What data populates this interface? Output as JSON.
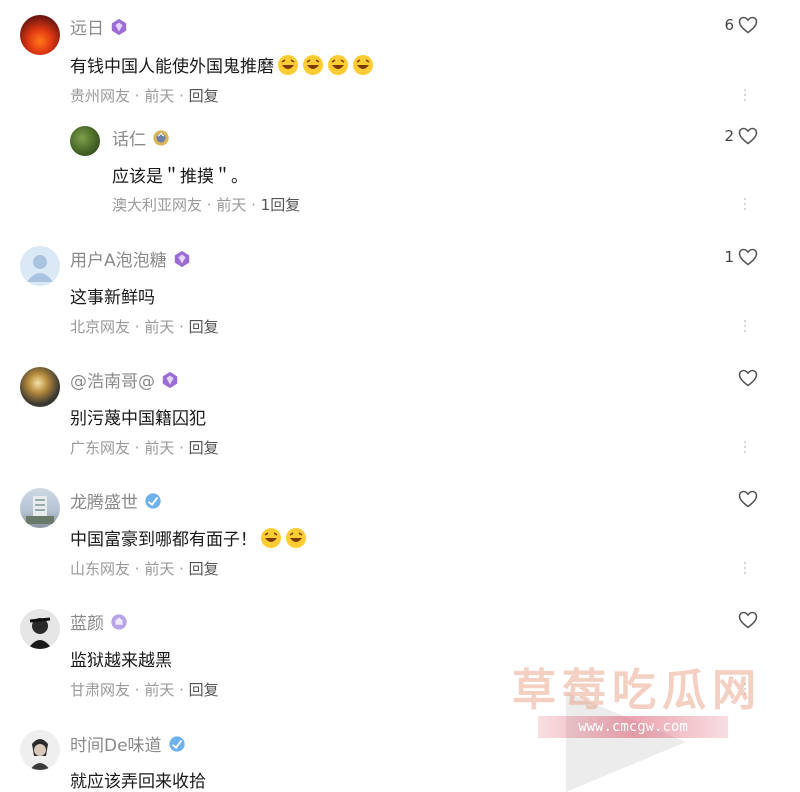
{
  "comments": [
    {
      "username": "远日",
      "badge": "purple-badge-icon",
      "text": "有钱中国人能使外国鬼推磨",
      "emoji_count": 4,
      "location": "贵州网友",
      "time": "前天",
      "reply": "回复",
      "likes": "6"
    },
    {
      "username": "话仁",
      "badge": "gold-badge-icon",
      "text": "应该是＂推摸＂。",
      "emoji_count": 0,
      "location": "澳大利亚网友",
      "time": "前天",
      "reply": "1回复",
      "likes": "2"
    },
    {
      "username": "用户A泡泡糖",
      "badge": "purple-badge-icon",
      "text": "这事新鲜吗",
      "emoji_count": 0,
      "location": "北京网友",
      "time": "前天",
      "reply": "回复",
      "likes": "1"
    },
    {
      "username": "@浩南哥@",
      "badge": "purple-badge-icon",
      "text": "别污蔑中国籍囚犯",
      "emoji_count": 0,
      "location": "广东网友",
      "time": "前天",
      "reply": "回复",
      "likes": ""
    },
    {
      "username": "龙腾盛世",
      "badge": "blue-badge-icon",
      "text": "中国富豪到哪都有面子！",
      "emoji_count": 2,
      "location": "山东网友",
      "time": "前天",
      "reply": "回复",
      "likes": ""
    },
    {
      "username": "蓝颜",
      "badge": "lilac-badge-icon",
      "text": "监狱越来越黑",
      "emoji_count": 0,
      "location": "甘肃网友",
      "time": "前天",
      "reply": "回复",
      "likes": ""
    },
    {
      "username": "时间De味道",
      "badge": "blue-badge-icon",
      "text": "就应该弄回来收拾",
      "emoji_count": 0,
      "location": "",
      "time": "",
      "reply": "",
      "likes": ""
    }
  ],
  "separator": " · ",
  "watermark": {
    "title": "草莓吃瓜网",
    "url": "www.cmcgw.com"
  }
}
